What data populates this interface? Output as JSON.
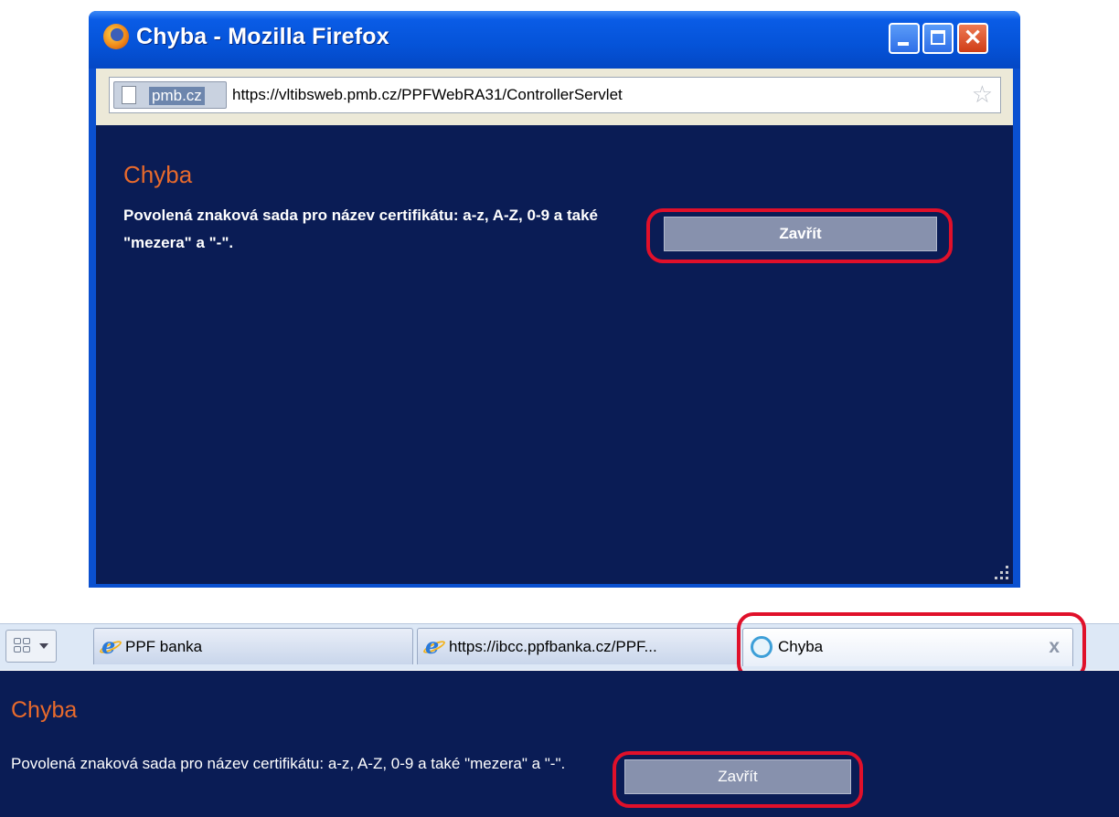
{
  "popup": {
    "title": "Chyba - Mozilla Firefox",
    "site_identity": "pmb.cz",
    "url": "https://vltibsweb.pmb.cz/PPFWebRA31/ControllerServlet",
    "heading": "Chyba",
    "message": "Povolená znaková sada pro název certifikátu: a-z, A-Z, 0-9 a také \"mezera\" a \"-\".",
    "button_label": "Zavřít"
  },
  "ie": {
    "tabs": [
      {
        "label": "PPF banka",
        "icon": "ie-icon"
      },
      {
        "label": "https://ibcc.ppfbanka.cz/PPF...",
        "icon": "ie-icon"
      },
      {
        "label": "Chyba",
        "icon": "loading-icon",
        "active": true
      }
    ],
    "tab_close_glyph": "x",
    "heading": "Chyba",
    "message": "Povolená znaková sada pro název certifikátu: a-z, A-Z, 0-9 a také \"mezera\" a \"-\".",
    "button_label": "Zavřít"
  },
  "colors": {
    "content_bg": "#0a1c55",
    "heading": "#e86a2c",
    "button_bg": "#8791ad",
    "highlight": "#e0102a"
  }
}
